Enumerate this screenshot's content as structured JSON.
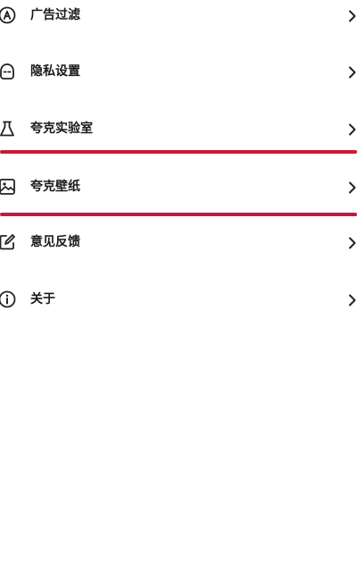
{
  "theme": {
    "highlight_color": "#c8193a",
    "text_color": "#1a1a1a",
    "icon_color": "#222222"
  },
  "menu": {
    "items": [
      {
        "label": "广告过滤",
        "icon": "ad-filter-icon"
      },
      {
        "label": "隐私设置",
        "icon": "privacy-icon"
      },
      {
        "label": "夸克实验室",
        "icon": "flask-icon"
      },
      {
        "label": "夸克壁纸",
        "icon": "wallpaper-icon"
      },
      {
        "label": "意见反馈",
        "icon": "feedback-icon"
      },
      {
        "label": "关于",
        "icon": "info-icon"
      }
    ]
  }
}
